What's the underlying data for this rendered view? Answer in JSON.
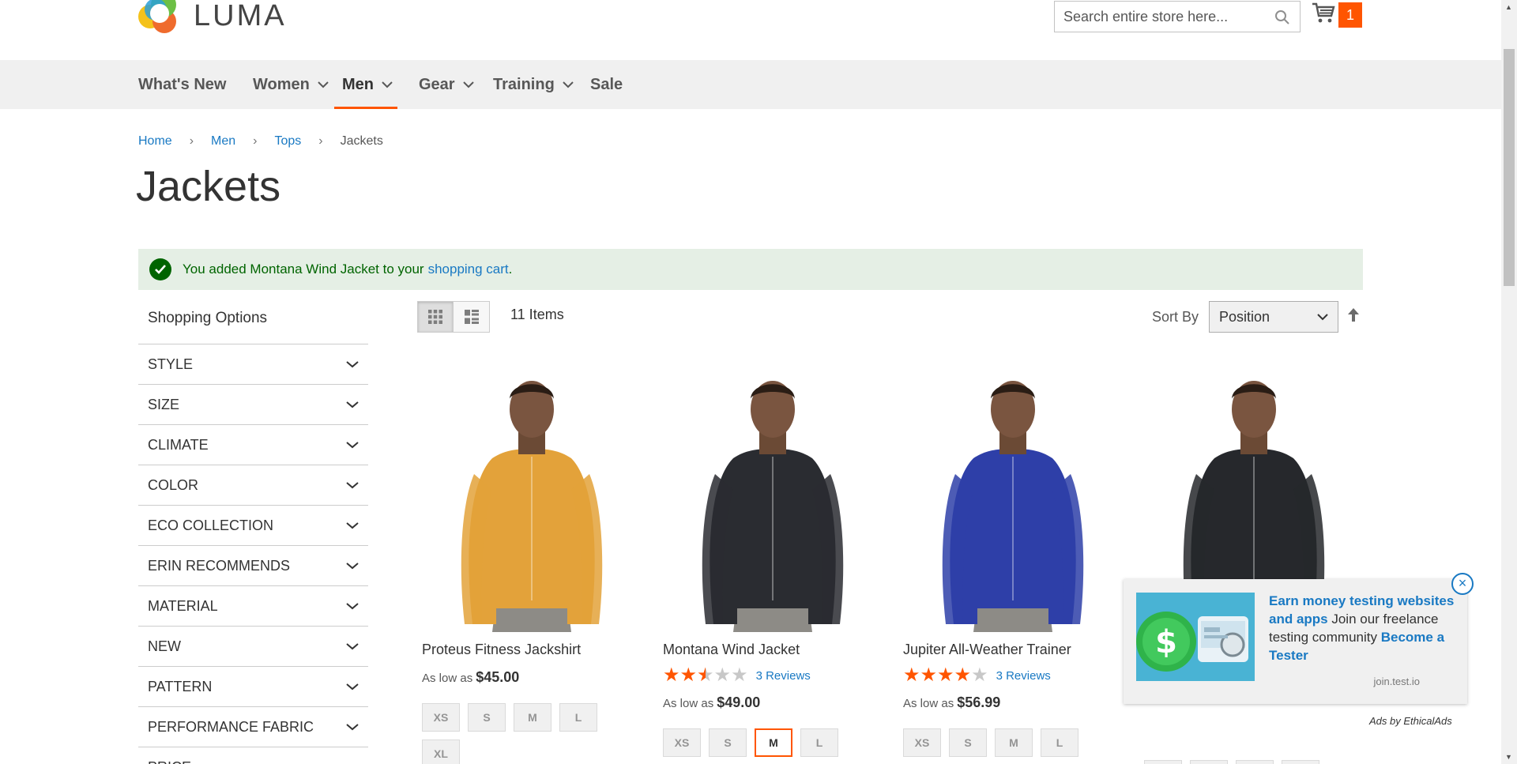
{
  "logo": {
    "text": "LUMA"
  },
  "search": {
    "placeholder": "Search entire store here..."
  },
  "cart": {
    "count": "1"
  },
  "nav": {
    "items": [
      {
        "label": "What's New",
        "dropdown": false
      },
      {
        "label": "Women",
        "dropdown": true
      },
      {
        "label": "Men",
        "dropdown": true,
        "active": true
      },
      {
        "label": "Gear",
        "dropdown": true
      },
      {
        "label": "Training",
        "dropdown": true
      },
      {
        "label": "Sale",
        "dropdown": false
      }
    ]
  },
  "breadcrumb": {
    "home": "Home",
    "men": "Men",
    "tops": "Tops",
    "current": "Jackets"
  },
  "page_title": "Jackets",
  "message": {
    "prefix": "You added Montana Wind Jacket to your ",
    "link": "shopping cart",
    "suffix": "."
  },
  "sidebar": {
    "title": "Shopping Options",
    "filters": [
      "STYLE",
      "SIZE",
      "CLIMATE",
      "COLOR",
      "ECO COLLECTION",
      "ERIN RECOMMENDS",
      "MATERIAL",
      "NEW",
      "PATTERN",
      "PERFORMANCE FABRIC",
      "PRICE"
    ]
  },
  "toolbar": {
    "items_count": "11 Items",
    "sort_label": "Sort By",
    "sort_value": "Position"
  },
  "products": [
    {
      "name": "Proteus Fitness Jackshirt",
      "price_prefix": "As low as",
      "price": "$45.00",
      "rating": null,
      "reviews": "",
      "sizes": [
        "XS",
        "S",
        "M",
        "L",
        "XL"
      ],
      "selected_size": "",
      "jacket_color": "#e3a23a"
    },
    {
      "name": "Montana Wind Jacket",
      "price_prefix": "As low as",
      "price": "$49.00",
      "rating": 2.5,
      "reviews": "3 Reviews",
      "sizes": [
        "XS",
        "S",
        "M",
        "L"
      ],
      "selected_size": "M",
      "jacket_color": "#2a2c31"
    },
    {
      "name": "Jupiter All-Weather Trainer",
      "price_prefix": "As low as",
      "price": "$56.99",
      "rating": 4,
      "reviews": "3 Reviews",
      "sizes": [
        "XS",
        "S",
        "M",
        "L"
      ],
      "selected_size": "",
      "jacket_color": "#2e3fa8"
    },
    {
      "name": "",
      "price_prefix": "",
      "price": "",
      "rating": null,
      "reviews": "",
      "sizes": [
        "XS",
        "S",
        "M",
        "L"
      ],
      "selected_size": "",
      "jacket_color": "#26282c"
    }
  ],
  "ad": {
    "headline": "Earn money testing websites and apps",
    "body": " Join our freelance testing community ",
    "cta": "Become a Tester",
    "domain": "join.test.io",
    "by": "Ads by EthicalAds",
    "close": "×"
  },
  "colors": {
    "accent": "#ff5501",
    "link": "#1979c3",
    "success_bg": "#e5efe5",
    "success_text": "#006400"
  }
}
